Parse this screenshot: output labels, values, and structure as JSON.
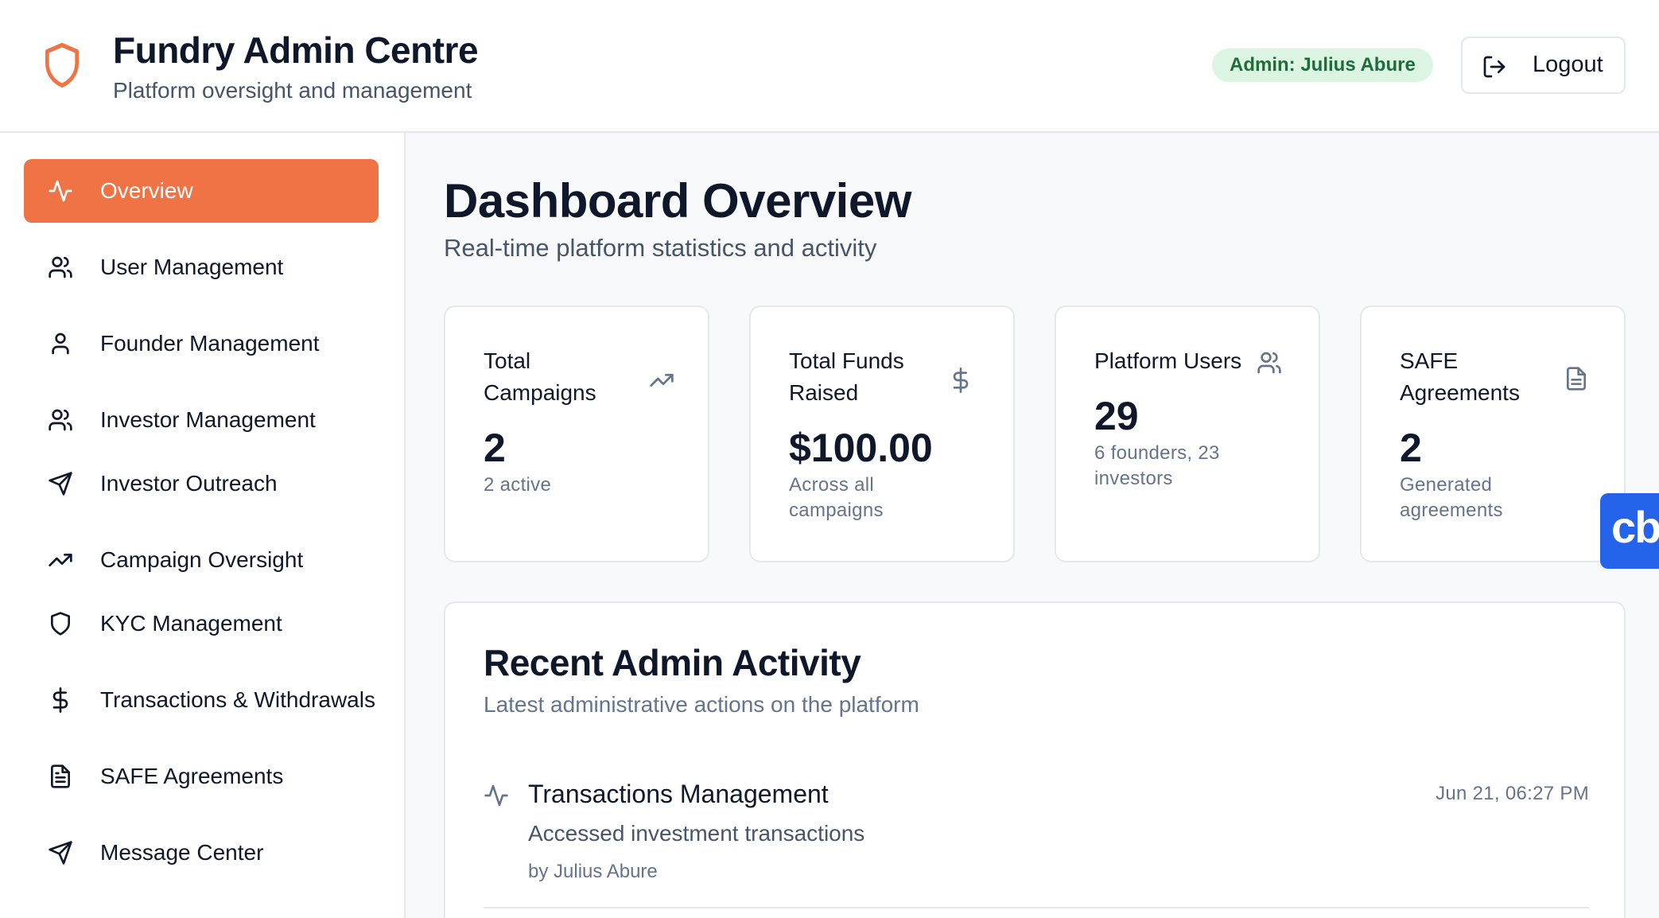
{
  "header": {
    "brand_icon": "shield-icon",
    "title": "Fundry Admin Centre",
    "subtitle": "Platform oversight and management",
    "admin_badge": "Admin: Julius Abure",
    "logout_label": "Logout",
    "logout_icon": "logout-icon"
  },
  "sidebar": {
    "items": [
      {
        "label": "Overview",
        "icon": "activity-icon",
        "active": true
      },
      {
        "label": "User Management",
        "icon": "users-icon",
        "active": false
      },
      {
        "label": "Founder Management",
        "icon": "user-icon",
        "active": false
      },
      {
        "label": "Investor Management",
        "icon": "users-icon",
        "active": false
      },
      {
        "label": "Investor Outreach",
        "icon": "send-icon",
        "active": false
      },
      {
        "label": "Campaign Oversight",
        "icon": "trending-up-icon",
        "active": false
      },
      {
        "label": "KYC Management",
        "icon": "shield-icon",
        "active": false
      },
      {
        "label": "Transactions & Withdrawals",
        "icon": "dollar-icon",
        "active": false
      },
      {
        "label": "SAFE Agreements",
        "icon": "file-text-icon",
        "active": false
      },
      {
        "label": "Message Center",
        "icon": "send-icon",
        "active": false
      }
    ]
  },
  "main": {
    "title": "Dashboard Overview",
    "subtitle": "Real-time platform statistics and activity",
    "stats": [
      {
        "label": "Total Campaigns",
        "value": "2",
        "note": "2 active",
        "icon": "trending-up-icon"
      },
      {
        "label": "Total Funds Raised",
        "value": "$100.00",
        "note": "Across all campaigns",
        "icon": "dollar-icon"
      },
      {
        "label": "Platform Users",
        "value": "29",
        "note": "6 founders, 23 investors",
        "icon": "users-icon"
      },
      {
        "label": "SAFE Agreements",
        "value": "2",
        "note": "Generated agreements",
        "icon": "file-text-icon"
      }
    ],
    "activity": {
      "title": "Recent Admin Activity",
      "subtitle": "Latest administrative actions on the platform",
      "items": [
        {
          "title": "Transactions Management",
          "description": "Accessed investment transactions",
          "by": "by Julius Abure",
          "time": "Jun 21, 06:27 PM",
          "icon": "activity-icon"
        }
      ]
    }
  },
  "widget": {
    "label": "cb"
  },
  "colors": {
    "accent": "#ef7344",
    "badge_bg": "#dcf5e3",
    "badge_text": "#1f6b3a",
    "widget": "#2563eb"
  }
}
